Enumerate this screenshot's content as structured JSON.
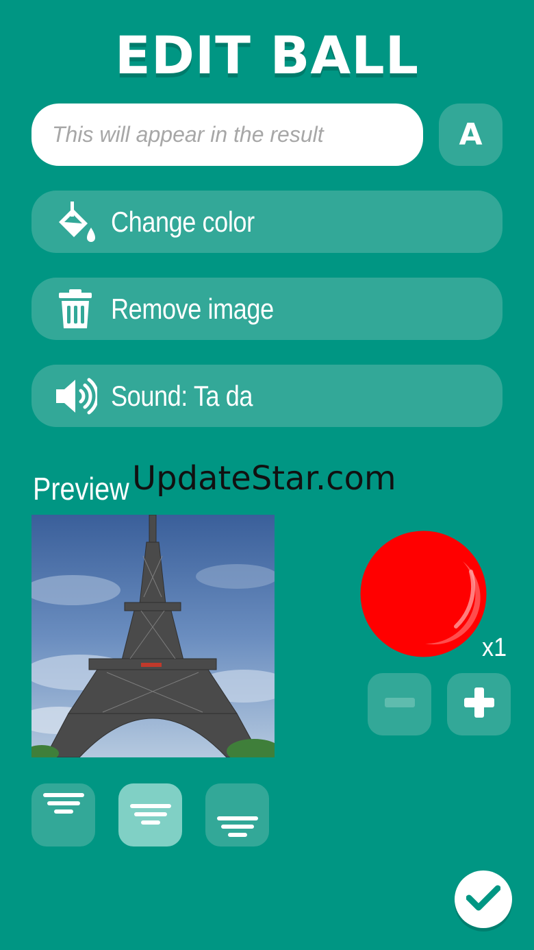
{
  "header": {
    "title": "EDIT BALL"
  },
  "text_field": {
    "placeholder": "This will appear in the result",
    "value": ""
  },
  "font_button": {
    "label": "A"
  },
  "actions": {
    "change_color": {
      "label": "Change color",
      "icon": "paint-bucket-icon"
    },
    "remove_image": {
      "label": "Remove image",
      "icon": "trash-icon"
    },
    "sound": {
      "label": "Sound: Ta da",
      "icon": "speaker-icon"
    }
  },
  "preview": {
    "label": "Preview",
    "image_subject": "eiffel-tower-photo",
    "ball_color": "#ff0000",
    "multiplier": "x1"
  },
  "watermark": {
    "text": "UpdateStar.com"
  },
  "stepper": {
    "minus_icon": "minus-icon",
    "plus_icon": "plus-icon",
    "minus_enabled": false
  },
  "text_alignment": {
    "options": [
      "align-top-icon",
      "align-middle-icon",
      "align-bottom-icon"
    ],
    "selected_index": 1
  },
  "confirm": {
    "icon": "checkmark-icon"
  },
  "colors": {
    "background": "#009683",
    "button": "#33a898",
    "button_selected": "#80d0c5",
    "accent_white": "#ffffff"
  }
}
